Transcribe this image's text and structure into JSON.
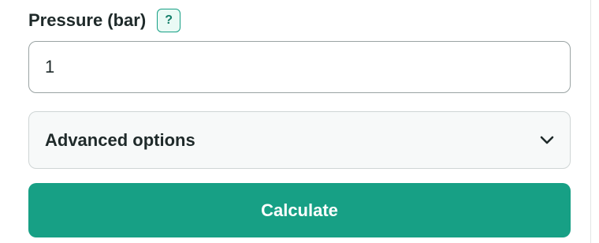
{
  "pressure_field": {
    "label": "Pressure (bar)",
    "help_label": "?",
    "value": "1"
  },
  "advanced_options": {
    "label": "Advanced options",
    "icon": "chevron-down-icon",
    "expanded": false
  },
  "calculate_button": {
    "label": "Calculate"
  },
  "colors": {
    "accent": "#17a085",
    "text": "#1f2a2a",
    "input_border": "#9aa3a3",
    "collapsible_bg": "#f7f9f9"
  }
}
